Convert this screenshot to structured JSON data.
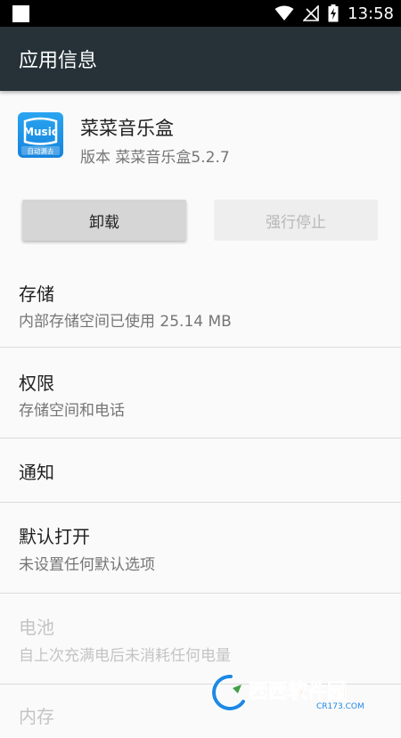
{
  "status_bar": {
    "time": "13:58"
  },
  "app_bar": {
    "title": "应用信息"
  },
  "app": {
    "icon_text": "Music",
    "icon_subtext": "自动漏去",
    "name": "菜菜音乐盒",
    "version": "版本 菜菜音乐盒5.2.7"
  },
  "buttons": {
    "uninstall": "卸载",
    "force_stop": "强行停止"
  },
  "items": [
    {
      "title": "存储",
      "subtitle": "内部存储空间已使用 25.14 MB"
    },
    {
      "title": "权限",
      "subtitle": "存储空间和电话"
    },
    {
      "title": "通知",
      "subtitle": ""
    },
    {
      "title": "默认打开",
      "subtitle": "未设置任何默认选项"
    },
    {
      "title": "电池",
      "subtitle": "自上次充满电后未消耗任何电量"
    },
    {
      "title": "内存",
      "subtitle": ""
    }
  ],
  "watermark": {
    "text": "西西软件园",
    "domain": "CR173.COM"
  },
  "colors": {
    "app_bar": "#263238",
    "status_bar": "#000000",
    "accent": "#1e88e5"
  }
}
